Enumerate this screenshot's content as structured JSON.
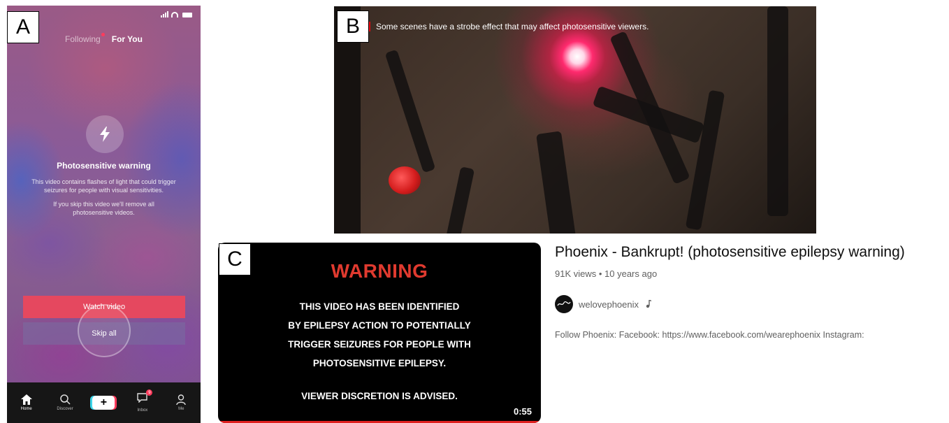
{
  "labels": {
    "a": "A",
    "b": "B",
    "c": "C"
  },
  "panel_a": {
    "tabs": {
      "following": "Following",
      "for_you": "For You"
    },
    "warning": {
      "title": "Photosensitive warning",
      "body": "This video contains flashes of light that could trigger seizures for people with visual sensitivities.",
      "skip_note": "If you skip this video we'll remove all photosensitive videos."
    },
    "buttons": {
      "watch": "Watch video",
      "skip": "Skip all"
    },
    "nav": {
      "home": "Home",
      "discover": "Discover",
      "create": "+",
      "inbox": "Inbox",
      "inbox_badge": "9",
      "me": "Me"
    },
    "icons": [
      "signal-icon",
      "wifi-icon",
      "battery-icon",
      "lightning-bolt-icon",
      "home-icon",
      "search-icon",
      "inbox-icon",
      "profile-icon"
    ]
  },
  "panel_b": {
    "notice": "Some scenes have a strobe effect that may affect photosensitive viewers."
  },
  "panel_c": {
    "heading": "WARNING",
    "lines": [
      "THIS VIDEO HAS BEEN IDENTIFIED",
      "BY EPILEPSY ACTION TO POTENTIALLY",
      "TRIGGER SEIZURES FOR PEOPLE WITH",
      "PHOTOSENSITIVE EPILEPSY."
    ],
    "discretion": "VIEWER DISCRETION IS ADVISED.",
    "duration": "0:55"
  },
  "youtube": {
    "title": "Phoenix - Bankrupt! (photosensitive epilepsy warning)",
    "meta": "91K views • 10 years ago",
    "channel": "welovephoenix",
    "channel_icon": "music-note-icon",
    "description": "Follow Phoenix: Facebook: https://www.facebook.com/wearephoenix Instagram:"
  },
  "colors": {
    "tiktok_red": "#e5485f",
    "warning_red": "#e03a2f",
    "netflix_red": "#e50914"
  }
}
